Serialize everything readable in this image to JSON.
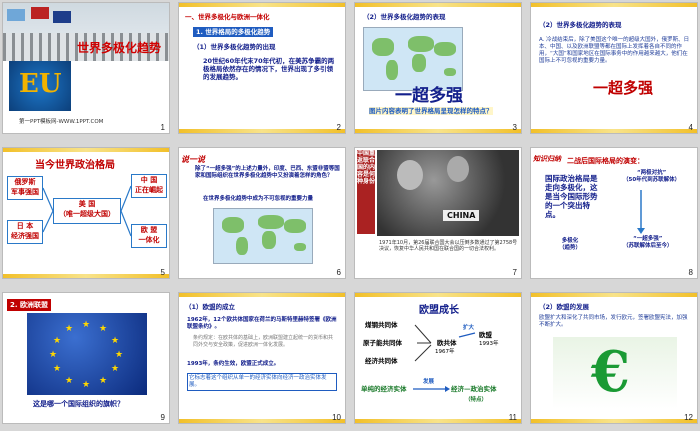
{
  "s1": {
    "title": "世界多极化趋势",
    "footer": "第一PPT模板网-WWW.1PPT.COM",
    "num": "1",
    "eu": "EU"
  },
  "s2": {
    "h1": "一、世界多极化与欧洲一体化",
    "h2": "1. 世界格局的多极化趋势",
    "h3": "（1）世界多极化趋势的出现",
    "body": "20世纪60年代末70年代初，在美苏争霸的两极格局依然存在的情况下，世界出现了多引领的发展趋势。",
    "num": "2"
  },
  "s3": {
    "h": "（2）世界多极化趋势的表现",
    "big": "一超多强",
    "q": "图片内容表明了世界格局呈现怎样的特点？",
    "num": "3"
  },
  "s4": {
    "h": "（2）世界多极化趋势的表现",
    "body": "A. 冷战结束后，除了美国这个唯一的超级大国外，俄罗斯、日本、中国、以及欧洲联盟等都在国际上发挥着各自不同的作用，“大国”和国家地区在国际事务中的作用越来越大，他们在国际上不可忽视的重要力量。",
    "big": "一超多强",
    "num": "4"
  },
  "s5": {
    "title": "当今世界政治格局",
    "l1": "俄罗斯",
    "l2": "军事强国",
    "center1": "美 国",
    "center2": "（唯一超级大国）",
    "r1": "中 国",
    "r2": "正在崛起",
    "l3": "日 本",
    "l4": "经济强国",
    "r3": "欧 盟",
    "r4": "一体化",
    "num": "5"
  },
  "s6": {
    "tag": "说一说",
    "body": "除了“一超多强”的上述力量外，印度、巴西、东盟非盟等国家和国际组织在世界多极化趋势中又扮演着怎样的角色？",
    "q": "在世界多极化趋势中成为不可忽视的重要力量",
    "num": "6"
  },
  "s7": {
    "side": "中国重返联合国的内容是何种身份",
    "caption": "1971年10月，第26届联合国大会以压倒多数通过了第2758号决议，恢复中华人民共和国在联合国的一切合法权利。",
    "china": "CHINA",
    "num": "7"
  },
  "s8": {
    "tag": "知识归纳",
    "title": "二战后国际格局的演变：",
    "main": "国际政治格局是走向多极化，这是当今国际形势的一个突出特点。",
    "a1": "“两极对抗”",
    "a2": "（50年代到苏联解体）",
    "b1": "多极化",
    "b2": "（趋势）",
    "c1": "“一超多强”",
    "c2": "（苏联解体后至今）",
    "num": "8"
  },
  "s9": {
    "h": "2. 欧洲联盟",
    "q": "这是哪一个国际组织的旗帜？",
    "num": "9"
  },
  "s10": {
    "h": "（1）欧盟的成立",
    "p1": "1962年，12个欧共体国家在荷兰的马斯特里赫特签署《欧洲联盟条约》。",
    "p2": "条约规定：在欧共体的基础上，欧洲联盟建立起统一的货币和共同外交与安全政策，促进欧洲一体化发展。",
    "p3": "1993年，条约生效，欧盟正式成立。",
    "note": "它标志着这个组织从单一的经济实体向经济一政治实体发展。",
    "num": "10"
  },
  "s11": {
    "title": "欧盟成长",
    "a": "煤钢共同体",
    "b": "原子能共同体",
    "c": "经济共同体",
    "mid": "欧共体",
    "y1": "1967年",
    "ext": "扩大",
    "eu": "欧盟",
    "y2": "1993年",
    "dev": "发展",
    "bottomL": "单纯的经济实体",
    "bottomR": "经济—政治实体",
    "feat": "（特点）",
    "num": "11"
  },
  "s12": {
    "h": "（2）欧盟的发展",
    "body": "欧盟扩大和深化了共同市场，发行欧元，签署欧盟宪法，加强不断扩大。",
    "num": "12"
  }
}
